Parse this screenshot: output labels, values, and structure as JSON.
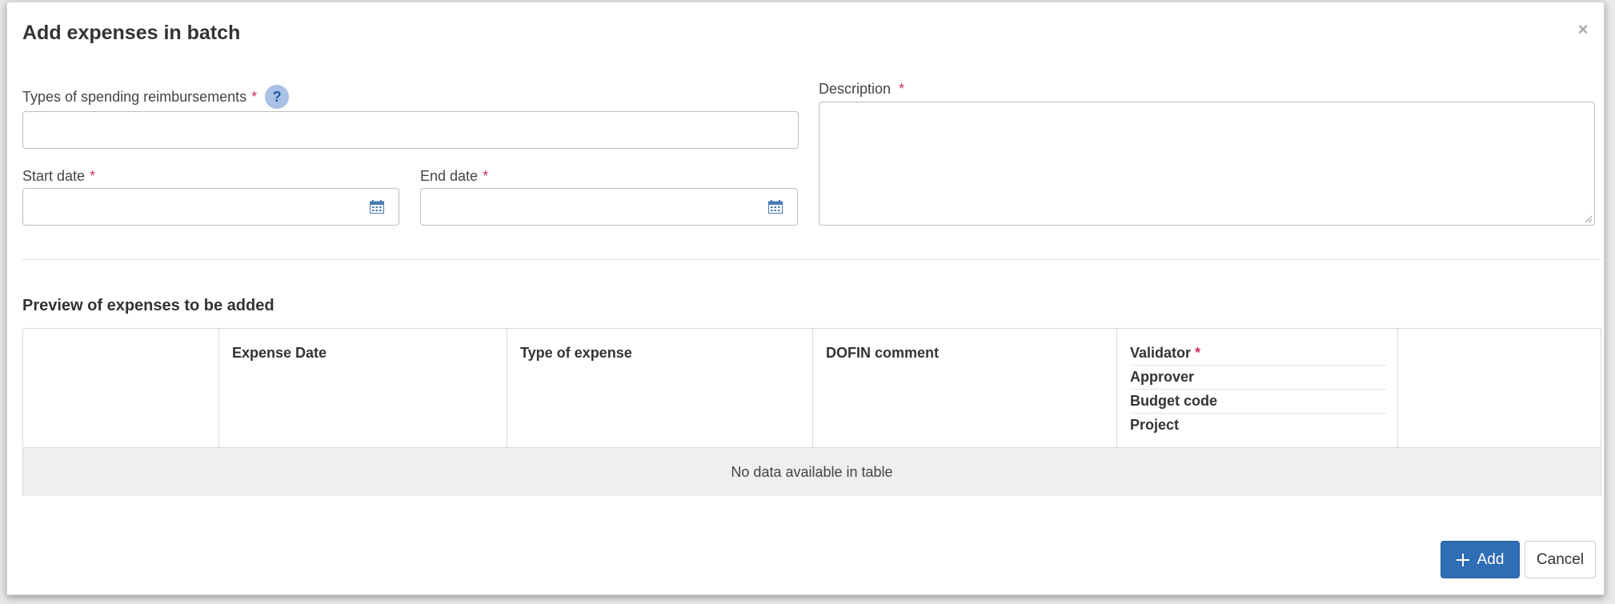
{
  "modal": {
    "title": "Add expenses in batch",
    "close_icon": "close-icon"
  },
  "form": {
    "types_label": "Types of spending reimbursements",
    "required_mark": "*",
    "help_badge": "?",
    "types_value": "",
    "start_date_label": "Start date",
    "start_date_value": "",
    "end_date_label": "End date",
    "end_date_value": "",
    "description_label": "Description",
    "description_value": ""
  },
  "preview": {
    "title": "Preview of expenses to be added",
    "columns": [
      "",
      "Expense Date",
      "Type of expense",
      "DOFIN comment",
      "",
      ""
    ],
    "stacked_header": [
      "Validator",
      "Approver",
      "Budget code",
      "Project"
    ],
    "empty_message": "No data available in table"
  },
  "buttons": {
    "add_label": "Add",
    "cancel_label": "Cancel"
  },
  "colors": {
    "primary": "#2f6db5",
    "required": "#c9306a",
    "help_badge_bg": "#a8c1e4"
  }
}
